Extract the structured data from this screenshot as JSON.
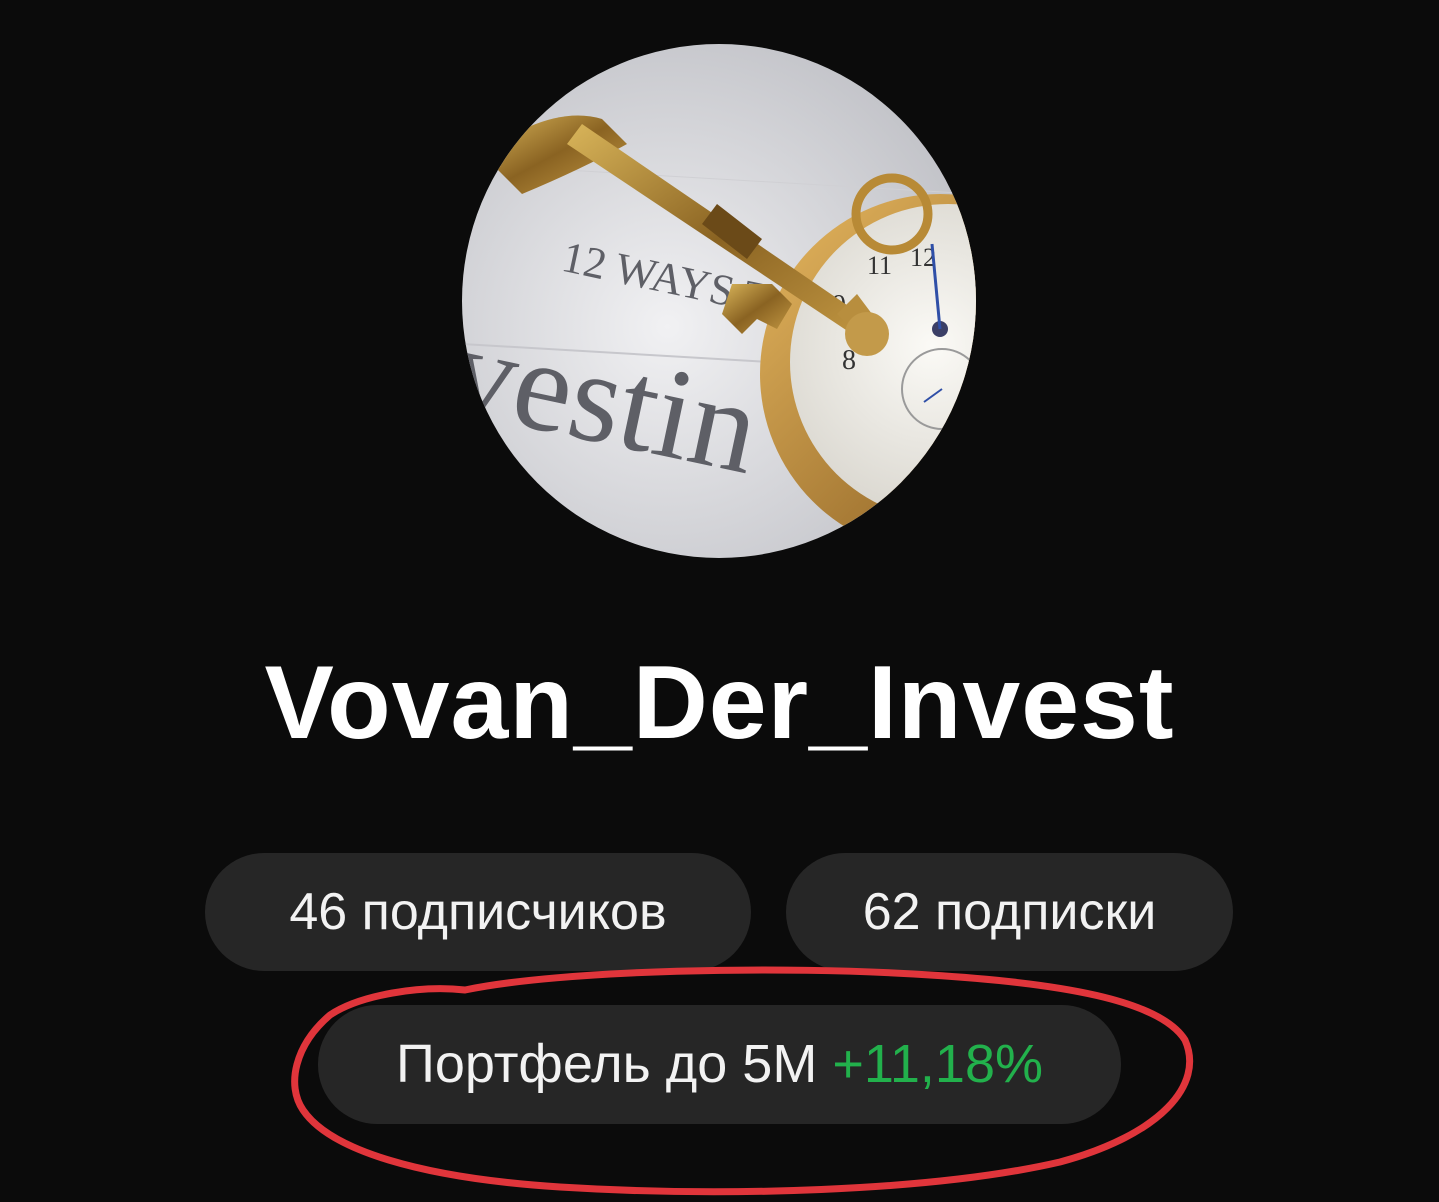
{
  "profile": {
    "avatar_icon": "investing-key-pocket-watch-photo",
    "avatar_text": "12 WAYS T\nvestin",
    "username": "Vovan_Der_Invest"
  },
  "stats": {
    "followers_label": "46 подписчиков",
    "following_label": "62 подписки"
  },
  "portfolio": {
    "label": "Портфель до 5М",
    "gain": "+11,18%",
    "gain_color": "#22b14c"
  },
  "colors": {
    "background": "#0b0b0b",
    "pill": "#262626",
    "highlight_stroke": "#e0353b"
  }
}
